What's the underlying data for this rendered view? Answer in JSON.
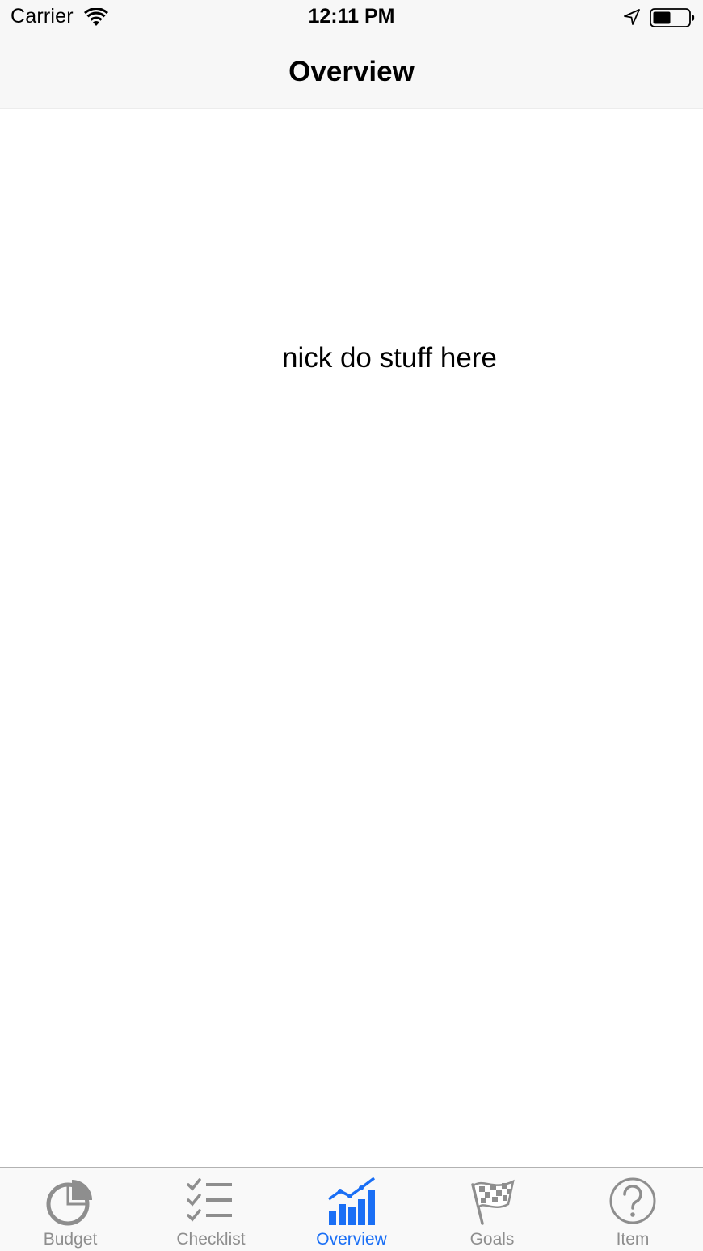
{
  "status_bar": {
    "carrier": "Carrier",
    "time": "12:11 PM",
    "icons": [
      "wifi-icon",
      "location-arrow-icon",
      "battery-icon"
    ],
    "battery_level": 0.5
  },
  "nav_bar": {
    "title": "Overview"
  },
  "content": {
    "text": "nick do stuff here"
  },
  "tab_bar": {
    "active_tab": "Overview",
    "active_color": "#1a6ff5",
    "inactive_color": "#8e8e8e",
    "tabs": [
      {
        "label": "Budget",
        "icon": "pie-chart-icon"
      },
      {
        "label": "Checklist",
        "icon": "checklist-icon"
      },
      {
        "label": "Overview",
        "icon": "bar-chart-icon"
      },
      {
        "label": "Goals",
        "icon": "checkered-flag-icon"
      },
      {
        "label": "Item",
        "icon": "question-circle-icon"
      }
    ]
  }
}
